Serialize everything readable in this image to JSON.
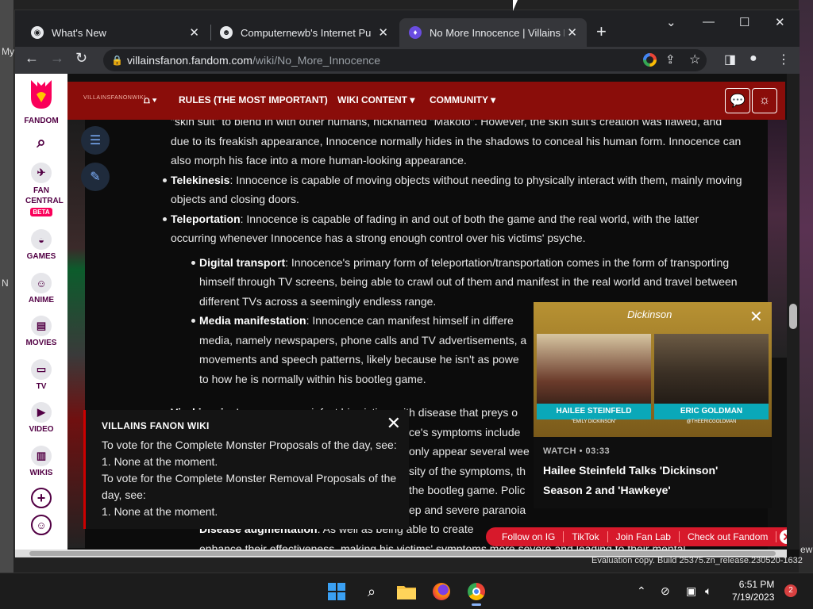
{
  "desktop": {
    "left_fragments": [
      "My",
      "N"
    ],
    "right_fragment": "ew",
    "watermark": "Evaluation copy. Build 25375.zn_release.230520-1632"
  },
  "browser": {
    "tabs": [
      {
        "title": "What's New",
        "icon": "chrome-icon"
      },
      {
        "title": "Computernewb's Internet Pub H",
        "icon": "pub-icon"
      },
      {
        "title": "No More Innocence | Villains Fan",
        "icon": "fandom-icon",
        "active": true
      }
    ],
    "url_host": "villainsfanon.fandom.com",
    "url_path": "/wiki/No_More_Innocence"
  },
  "fandom_rail": {
    "logo_label": "FANDOM",
    "items": [
      {
        "label": "FAN CENTRAL",
        "badge": "BETA",
        "icon": "rocket-icon"
      },
      {
        "label": "GAMES",
        "icon": "gamepad-icon"
      },
      {
        "label": "ANIME",
        "icon": "anime-icon"
      },
      {
        "label": "MOVIES",
        "icon": "clapper-icon"
      },
      {
        "label": "TV",
        "icon": "tv-icon"
      },
      {
        "label": "VIDEO",
        "icon": "play-icon"
      },
      {
        "label": "WIKIS",
        "icon": "book-icon"
      }
    ]
  },
  "wiki_nav": {
    "wordmark": "VILLAINSFANONWIKI",
    "links": [
      "RULES (THE MOST IMPORTANT)",
      "WIKI CONTENT",
      "COMMUNITY"
    ]
  },
  "article": {
    "intro": "\"skin suit\" to blend in with other humans, nicknamed \"Makoto\". However, the skin suit's creation was flawed, and due to its freakish appearance, Innocence normally hides in the shadows to conceal his human form. Innocence can also morph his face into a more human-looking appearance.",
    "telekinesis_term": "Telekinesis",
    "telekinesis_text": ": Innocence is capable of moving objects without needing to physically interact with them, mainly moving objects and closing doors.",
    "teleportation_term": "Teleportation",
    "teleportation_text": ": Innocence is capable of fading in and out of both the game and the real world, with the latter occurring whenever Innocence has a strong enough control over his victims' psyche.",
    "digital_term": "Digital transport",
    "digital_text": ": Innocence's primary form of teleportation/transportation comes in the form of transporting himself through TV screens, being able to crawl out of them and manifest in the real world and travel between different TVs across a seemingly endless range.",
    "media_term": "Media manifestation",
    "media_line1": ": Innocence can manifest himself in differe",
    "media_line2": "media, namely newspapers, phone calls and TV advertisements, a",
    "media_line3": "movements and speech patterns, likely because he isn't as powe",
    "media_line4": "to how he is normally within his bootleg game.",
    "virulence_term": "Virokinesis",
    "virulence_line1": ": Innocence can infect his victims with disease that preys o",
    "hidden_line2": "ce's symptoms include",
    "hidden_line3": "only appear several wee",
    "hidden_line4": "sity of the symptoms, th",
    "hidden_line5": "the bootleg game. Polic",
    "hidden_line6": "ep and severe paranoia",
    "disease_term": "Disease augmentation",
    "disease_text": ": As well as being able to create",
    "last_line": "enhance their effectiveness, making his victims' symptoms more severe and leading to their mental"
  },
  "notice": {
    "title": "VILLAINS FANON WIKI",
    "line1": "To vote for the Complete Monster Proposals of the day, see:",
    "line2": "1. None at the moment.",
    "line3": "To vote for the Complete Monster Removal Proposals of the",
    "line4": "day, see:",
    "line5": "1. None at the moment."
  },
  "video": {
    "show_title": "Dickinson",
    "left_name": "HAILEE STEINFELD",
    "left_sub": "\"EMILY DICKINSON\"",
    "right_name": "ERIC GOLDMAN",
    "right_sub": "@THEERICGOLDMAN",
    "watch_label": "WATCH • 03:33",
    "headline": "Hailee Steinfeld Talks 'Dickinson' Season 2 and 'Hawkeye'"
  },
  "social_bar": [
    "Follow on IG",
    "TikTok",
    "Join Fan Lab",
    "Check out Fandom"
  ],
  "taskbar": {
    "time": "6:51 PM",
    "date": "7/19/2023",
    "notifications": "2"
  },
  "colors": {
    "wiki_nav": "#8a0d0a",
    "fandom_pink": "#fa005a",
    "social_red": "#d7192b"
  }
}
